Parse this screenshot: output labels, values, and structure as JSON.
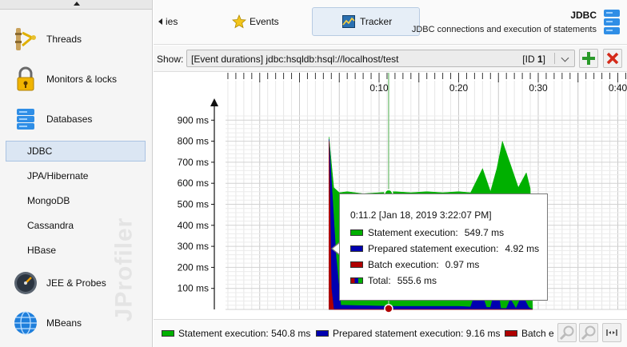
{
  "sidebar": {
    "major": [
      {
        "label": "Threads",
        "icon": "threads-icon"
      },
      {
        "label": "Monitors & locks",
        "icon": "lock-icon"
      },
      {
        "label": "Databases",
        "icon": "database-icon"
      }
    ],
    "db_items": [
      "JDBC",
      "JPA/Hibernate",
      "MongoDB",
      "Cassandra",
      "HBase"
    ],
    "selected": "JDBC",
    "after": [
      {
        "label": "JEE & Probes",
        "icon": "gauge-icon"
      },
      {
        "label": "MBeans",
        "icon": "globe-icon"
      }
    ],
    "watermark": "JProfiler"
  },
  "tabs": {
    "partial": "ies",
    "events": "Events",
    "tracker": "Tracker",
    "active": "Tracker"
  },
  "header": {
    "title": "JDBC",
    "description": "JDBC connections and execution of statements"
  },
  "toolbar": {
    "show_label": "Show:",
    "select_value": "[Event durations] jdbc:hsqldb:hsql://localhost/test",
    "select_id_prefix": "[ID ",
    "select_id_num": "1",
    "select_id_suffix": "]"
  },
  "chart_data": {
    "type": "area",
    "title": "",
    "time_ticks": [
      "0:10",
      "0:20",
      "0:30",
      "0:40"
    ],
    "y_ticks": [
      "100 ms",
      "200 ms",
      "300 ms",
      "400 ms",
      "500 ms",
      "600 ms",
      "700 ms",
      "800 ms",
      "900 ms"
    ],
    "ylim": [
      0,
      950
    ],
    "xlim_seconds": [
      -3,
      44
    ],
    "series": [
      {
        "name": "Statement execution",
        "color": "#00b000",
        "points": [
          [
            3.7,
            0
          ],
          [
            3.7,
            820
          ],
          [
            4.3,
            580
          ],
          [
            5,
            555
          ],
          [
            6,
            560
          ],
          [
            8,
            550
          ],
          [
            10,
            555
          ],
          [
            12,
            560
          ],
          [
            14,
            555
          ],
          [
            16,
            560
          ],
          [
            18,
            555
          ],
          [
            20,
            560
          ],
          [
            21.5,
            555
          ],
          [
            23,
            670
          ],
          [
            24,
            560
          ],
          [
            24.8,
            670
          ],
          [
            25.5,
            800
          ],
          [
            26.5,
            690
          ],
          [
            27.5,
            580
          ],
          [
            28.5,
            650
          ],
          [
            29,
            575
          ],
          [
            29.3,
            0
          ]
        ]
      },
      {
        "name": "Prepared statement execution",
        "color": "#0000b0",
        "points": [
          [
            3.7,
            0
          ],
          [
            3.7,
            810
          ],
          [
            4.1,
            560
          ],
          [
            4.6,
            250
          ],
          [
            5.2,
            20
          ],
          [
            12,
            15
          ],
          [
            20,
            15
          ],
          [
            21.5,
            12
          ],
          [
            22.5,
            120
          ],
          [
            23.5,
            10
          ],
          [
            24,
            10
          ],
          [
            24.8,
            130
          ],
          [
            25.3,
            5
          ],
          [
            26,
            5
          ],
          [
            26.5,
            50
          ],
          [
            27.2,
            5
          ],
          [
            28,
            70
          ],
          [
            28.8,
            10
          ],
          [
            29.3,
            0
          ]
        ]
      },
      {
        "name": "Batch execution",
        "color": "#b00000",
        "points": [
          [
            3.7,
            0
          ],
          [
            3.7,
            800
          ],
          [
            4.0,
            100
          ],
          [
            4.3,
            0
          ],
          [
            6,
            0
          ],
          [
            12,
            0
          ],
          [
            20,
            0
          ],
          [
            29.3,
            0
          ]
        ]
      }
    ],
    "cursor": {
      "time": "0:11.2 [Jan 18, 2019 3:22:07 PM]",
      "seconds": 11.2
    },
    "tooltip_rows": [
      {
        "name": "Statement execution:",
        "value": "549.7 ms",
        "color": "#00b000"
      },
      {
        "name": "Prepared statement execution:",
        "value": "4.92 ms",
        "color": "#0000b0"
      },
      {
        "name": "Batch execution:",
        "value": "0.97 ms",
        "color": "#b00000"
      },
      {
        "name": "Total:",
        "value": "555.6 ms",
        "color": "multi"
      }
    ]
  },
  "legend": [
    {
      "label": "Statement execution: 540.8 ms",
      "color": "#00b000"
    },
    {
      "label": "Prepared statement execution: 9.16 ms",
      "color": "#0000b0"
    },
    {
      "label": "Batch e",
      "color": "#b00000"
    }
  ]
}
